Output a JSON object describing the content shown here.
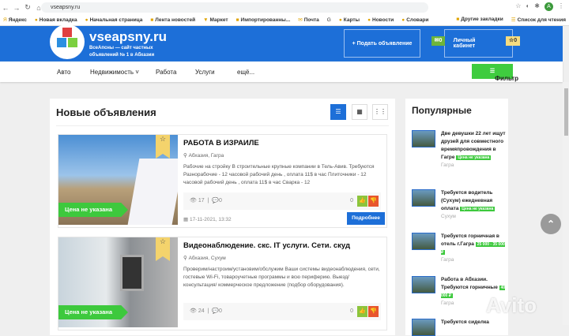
{
  "browser": {
    "url": "vseapsny.ru",
    "profile_initial": "A",
    "bookmarks": [
      "Яндекс",
      "Новая вкладка",
      "Начальная страница",
      "Лента новостей",
      "Маркет",
      "Импортированны...",
      "Почта",
      "G",
      "Карты",
      "Новости",
      "Словари"
    ],
    "bookmarks_right": [
      "Другие закладки",
      "Список для чтения"
    ]
  },
  "header": {
    "site_name": "vseapsny.ru",
    "tagline": "ВсеАпсны — сайт частных объявлений № 1 в Абхазии",
    "post_ad": "+ Подать объявление",
    "messages_count": "0",
    "cabinet": "Личный кабинет",
    "favorites_count": "0"
  },
  "nav": {
    "items": [
      "Авто",
      "Недвижимость ˅",
      "Работа",
      "Услуги",
      "ещё..."
    ],
    "filter": "Фильтр"
  },
  "main": {
    "title": "Новые объявления",
    "listings": [
      {
        "title": "РАБОТА В ИЗРАИЛЕ",
        "location": "Абхазия, Гагра",
        "description": "Рабочие на стройку В строительные крупные компании в Тель-Авив. Требуются Разнорабочие - 12 часовой рабочий день , оплата 11$ в час Плиточники - 12 часовой рабочий день , оплата 11$ в час Сварка - 12",
        "views": "17",
        "comments": "0",
        "rating": "0",
        "price": "Цена не указана",
        "date": "17-11-2021, 13:32",
        "more": "Подробнее"
      },
      {
        "title": "Видеонаблюдение. скс. IT услуги. Сети. скуд",
        "location": "Абхазия, Сухум",
        "description": "Проверим/настроим/установим/обслужим Ваши системы видеонаблюдения, сети, гостевые Wi-Fi, товароучетные программы и всю периферию. Выезд/ консультация/ коммерческое предложение (подбор оборудования).",
        "views": "24",
        "comments": "0",
        "rating": "0",
        "price": "Цена не указана"
      }
    ]
  },
  "sidebar": {
    "title": "Популярные",
    "items": [
      {
        "title": "Две девушки 22 лет ищут друзей для совместного времяпровождения в Гагре",
        "price": "Цена не указана",
        "city": "Гагра"
      },
      {
        "title": "Требуется водитель (Сухум) ежедневная оплата",
        "price": "Цена не указана",
        "city": "Сухум"
      },
      {
        "title": "Требуется горничная в отель г.Гагра",
        "price": "25 000 - 35 000 ₽",
        "city": "Гагра"
      },
      {
        "title": "Работа в Абхазии. Требуются горничные",
        "price": "40 000 ₽",
        "city": "Гагра"
      },
      {
        "title": "Требуется сиделка"
      }
    ]
  },
  "watermark": "Avito"
}
